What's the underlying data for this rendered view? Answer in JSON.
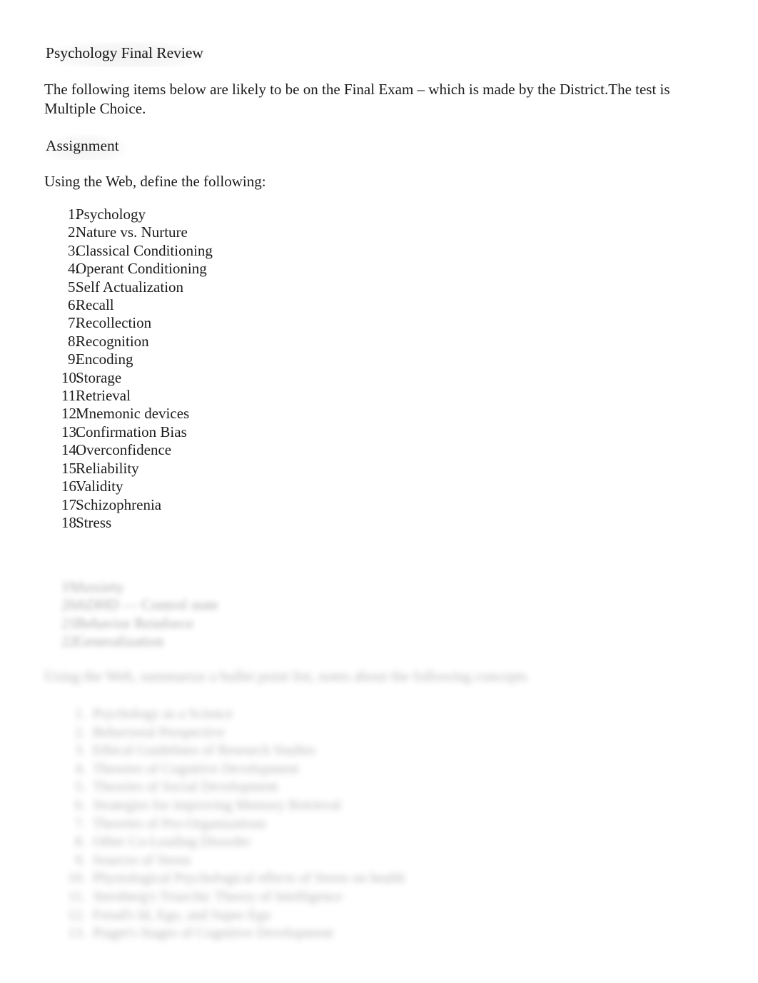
{
  "document": {
    "title": "Psychology Final Review",
    "intro_paragraph": "The following items below are likely to be on the Final Exam – which is made by the District.The test is Multiple Choice.",
    "section_heading": "Assignment",
    "instruction": "Using the Web, define the following:",
    "definition_list": [
      {
        "number": "1.",
        "label": "Psychology"
      },
      {
        "number": "2.",
        "label": "Nature vs. Nurture"
      },
      {
        "number": "3.",
        "label": "Classical Conditioning"
      },
      {
        "number": "4.",
        "label": "Operant Conditioning"
      },
      {
        "number": "5.",
        "label": "Self Actualization"
      },
      {
        "number": "6.",
        "label": "Recall"
      },
      {
        "number": "7.",
        "label": "Recollection"
      },
      {
        "number": "8.",
        "label": "Recognition"
      },
      {
        "number": "9.",
        "label": "Encoding"
      },
      {
        "number": "10.",
        "label": "Storage"
      },
      {
        "number": "11.",
        "label": "Retrieval"
      },
      {
        "number": "12.",
        "label": "Mnemonic devices"
      },
      {
        "number": "13.",
        "label": "Confirmation Bias"
      },
      {
        "number": "14.",
        "label": "Overconfidence"
      },
      {
        "number": "15.",
        "label": "Reliability"
      },
      {
        "number": "16.",
        "label": "Validity"
      },
      {
        "number": "17.",
        "label": "Schizophrenia"
      },
      {
        "number": "18.",
        "label": "Stress"
      }
    ],
    "definition_list_obscured": [
      {
        "number": "19.",
        "label": "Anxiety"
      },
      {
        "number": "20.",
        "label": "ADHD — Control state"
      },
      {
        "number": "21.",
        "label": "Behavior Reinforce"
      },
      {
        "number": "22.",
        "label": "Generalization"
      }
    ],
    "second_instruction_obscured": "Using the Web, summarize a bullet point list, notes about the following concepts",
    "concept_list_obscured": [
      {
        "number": "1.",
        "label": "Psychology as a Science"
      },
      {
        "number": "2.",
        "label": "Behavioral Perspective"
      },
      {
        "number": "3.",
        "label": "Ethical Guidelines of Research Studies"
      },
      {
        "number": "4.",
        "label": "Theories of Cognitive Development"
      },
      {
        "number": "5.",
        "label": "Theories of Social Development"
      },
      {
        "number": "6.",
        "label": "Strategies for improving Memory Retrieval"
      },
      {
        "number": "7.",
        "label": "Theories of Pro-Organizations"
      },
      {
        "number": "8.",
        "label": "Other Co-Leading Disorder"
      },
      {
        "number": "9.",
        "label": "Sources of Stress"
      },
      {
        "number": "10.",
        "label": "Physiological Psychological effects of Stress on health"
      },
      {
        "number": "11.",
        "label": "Sternberg's Triarchic Theory of Intelligence"
      },
      {
        "number": "12.",
        "label": "Freud's Id, Ego, and Super Ego"
      },
      {
        "number": "13.",
        "label": "Piaget's Stages of Cognitive Development"
      }
    ]
  }
}
